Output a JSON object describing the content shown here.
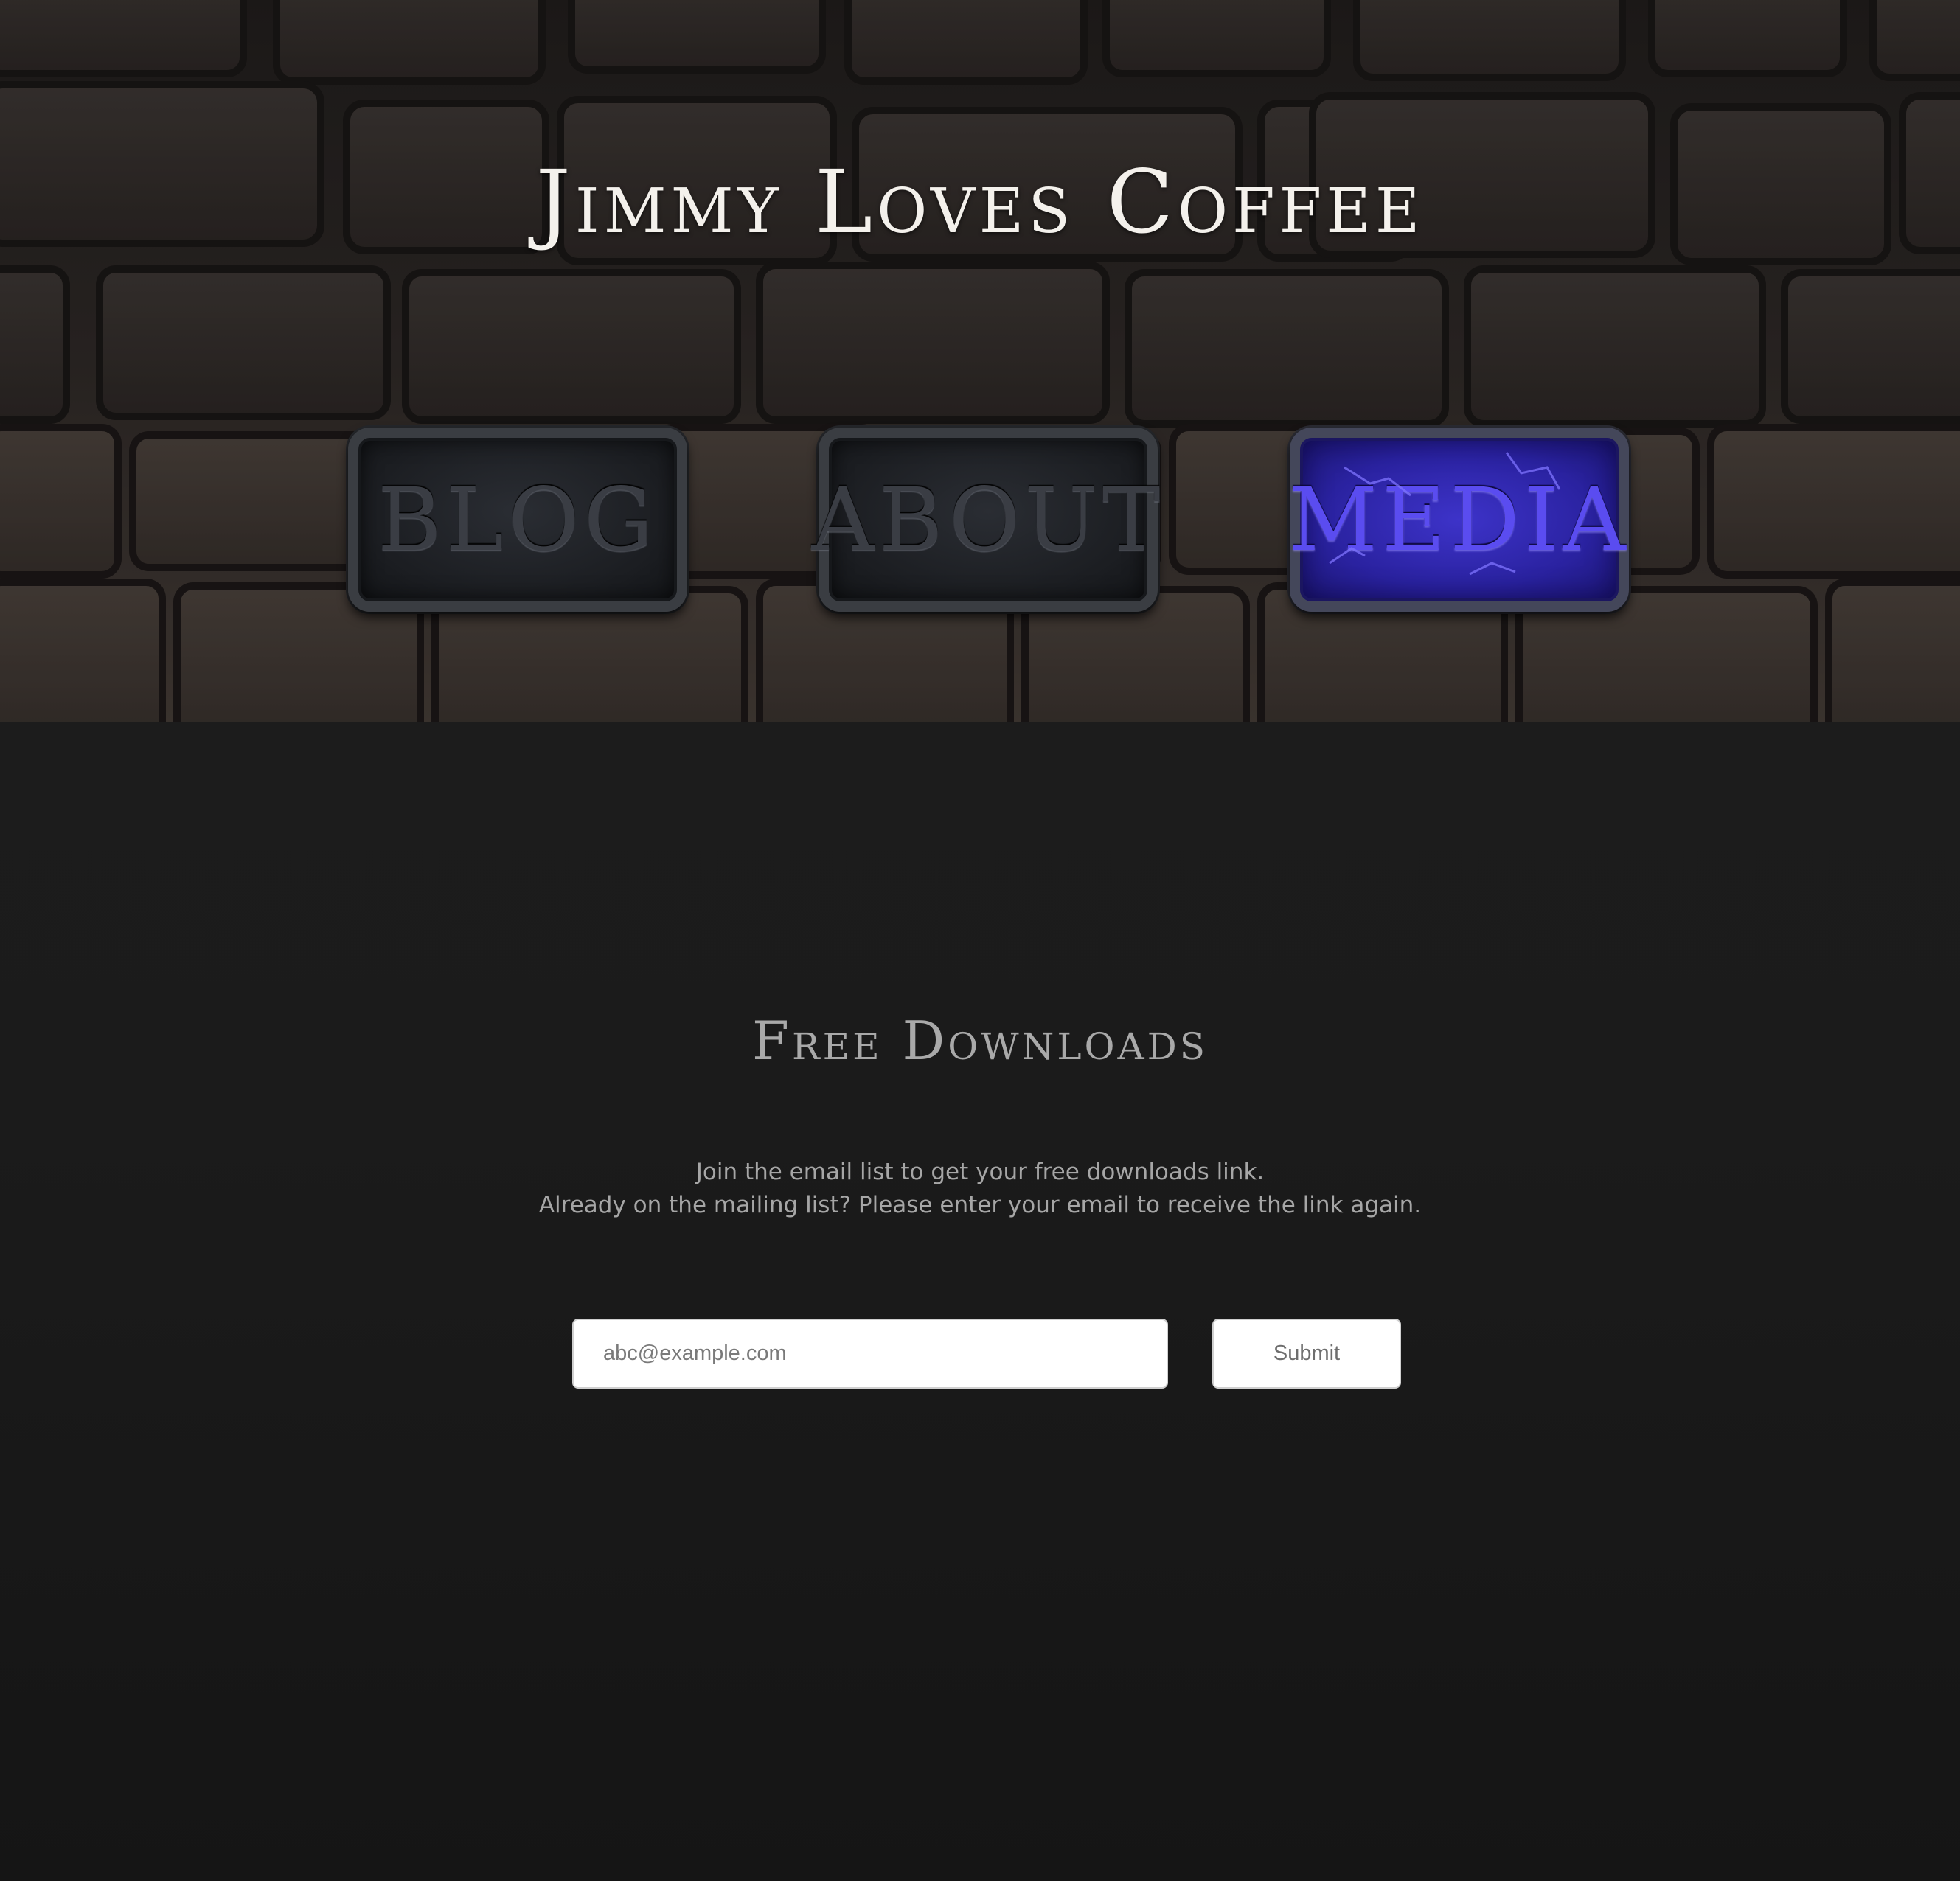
{
  "header": {
    "site_title": "Jimmy Loves Coffee"
  },
  "nav": {
    "items": [
      {
        "label": "BLOG",
        "state": "normal"
      },
      {
        "label": "ABOUT",
        "state": "normal"
      },
      {
        "label": "MEDIA",
        "state": "active"
      }
    ]
  },
  "downloads": {
    "title": "Free Downloads",
    "line1": "Join the email list to get your free downloads link.",
    "line2": "Already on the mailing list? Please enter your email to receive the link again.",
    "email_placeholder": "abc@example.com",
    "submit_label": "Submit"
  },
  "colors": {
    "page_background": "#1b1b1b",
    "title_text": "#f4f1ec",
    "active_plaque": "#3d33c9",
    "section_title": "#a9a9a9",
    "body_text": "#a6a6a6"
  }
}
